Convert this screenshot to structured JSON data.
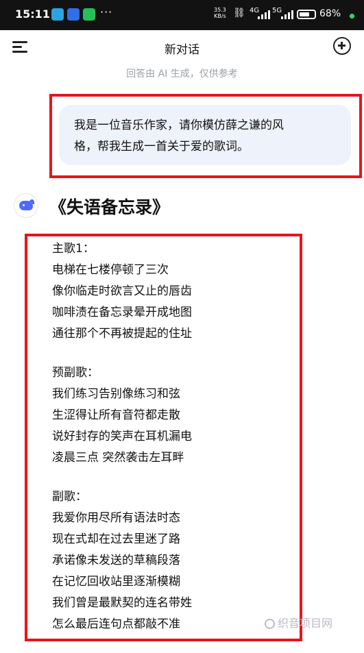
{
  "status_bar": {
    "time": "15:11",
    "dots": "···",
    "net_speed": "35.3",
    "net_unit": "KB/s",
    "g4": "4G",
    "g5": "5G",
    "battery_text": "68%",
    "battery_level": 0.68
  },
  "header": {
    "title": "新对话",
    "disclaimer": "回答由 AI 生成，仅供参考"
  },
  "user_message": {
    "lines": [
      "我是一位音乐作家，请你模仿薛之谦的风",
      "格，帮我生成一首关于爱的歌词。"
    ]
  },
  "assistant": {
    "song_title": "《失语备忘录》",
    "stanzas": [
      {
        "label": "主歌1：",
        "lines": [
          "电梯在七楼停顿了三次",
          "像你临走时欲言又止的唇齿",
          "咖啡渍在备忘录晕开成地图",
          "通往那个不再被提起的住址"
        ]
      },
      {
        "label": "预副歌：",
        "lines": [
          "我们练习告别像练习和弦",
          "生涩得让所有音符都走散",
          "说好封存的笑声在耳机漏电",
          "凌晨三点 突然袭击左耳畔"
        ]
      },
      {
        "label": "副歌：",
        "lines": [
          "我爱你用尽所有语法时态",
          "现在式却在过去里迷了路",
          "承诺像未发送的草稿段落",
          "在记忆回收站里逐渐模糊",
          "我们曾是最默契的连名带姓",
          "怎么最后连句点都敲不准"
        ]
      }
    ]
  },
  "watermark": "织音项目网",
  "colors": {
    "highlight_border": "#e8141c",
    "bubble_bg": "#eef2fb",
    "accent": "#4d6bfe"
  }
}
